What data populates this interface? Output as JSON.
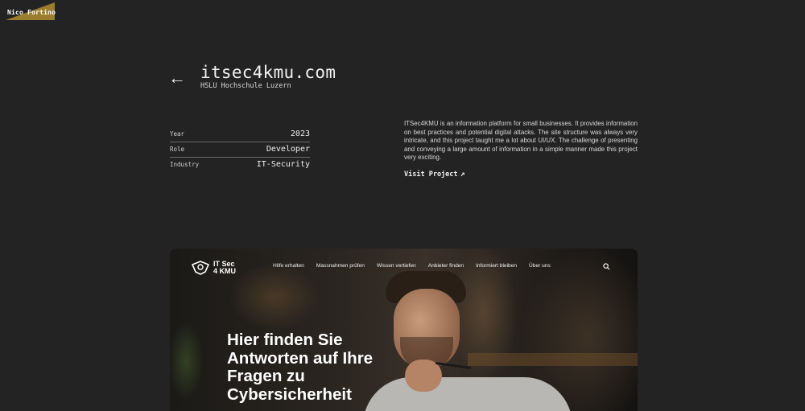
{
  "brand": {
    "name": "Nico Fortino",
    "accent": "#9a7d2e"
  },
  "project": {
    "back_label": "←",
    "title": "itsec4kmu.com",
    "subtitle": "HSLU Hochschule Luzern",
    "meta": [
      {
        "label": "Year",
        "value": "2023"
      },
      {
        "label": "Role",
        "value": "Developer"
      },
      {
        "label": "Industry",
        "value": "IT-Security"
      }
    ],
    "description": "ITSec4KMU is an information platform for small businesses. It provides information on best practices and potential digital attacks. The site structure was always very intricate, and this project taught me a lot about UI/UX. The challenge of presenting and conveying a large amount of information in a simple manner made this project very exciting.",
    "visit_label": "Visit Project",
    "visit_arrow": "↗"
  },
  "preview": {
    "site_name_line1": "IT Sec",
    "site_name_line2": "4 KMU",
    "nav": [
      "Hilfe erhalten",
      "Massnahmen prüfen",
      "Wissen vertiefen",
      "Anbieter finden",
      "Informiert bleiben",
      "Über uns"
    ],
    "search_icon": "search-icon",
    "hero_line1": "Hier finden Sie",
    "hero_line2": "Antworten auf Ihre",
    "hero_line3": "Fragen zu",
    "hero_line4": "Cybersicherheit"
  }
}
